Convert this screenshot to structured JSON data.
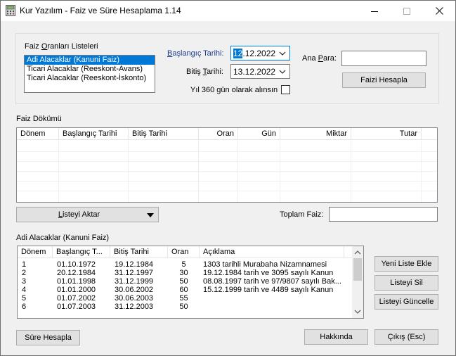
{
  "window": {
    "title": "Kur Yazılım - Faiz ve Süre Hesaplama 1.14",
    "minimize": "—",
    "maximize": "☐",
    "close": "✕"
  },
  "rates_group": {
    "label": "Faiz Oranları Listeleri",
    "items": [
      "Adi Alacaklar (Kanuni Faiz)",
      "Ticari Alacaklar (Reeskont-Avans)",
      "Ticari Alacaklar (Reeskont-İskonto)"
    ],
    "selected_index": 0
  },
  "dates": {
    "start_label": "Başlangıç Tarihi:",
    "start_value_sel": "12",
    "start_value_rest": ".12.2022",
    "end_label": "Bitiş Tarihi:",
    "end_value": "13.12.2022",
    "year360_label": "Yıl 360 gün olarak alınsın",
    "year360_checked": false
  },
  "principal": {
    "label": "Ana Para:",
    "value": "",
    "compute_button": "Faizi Hesapla"
  },
  "interest_breakdown": {
    "label": "Faiz Dökümü",
    "columns": [
      "Dönem",
      "Başlangıç Tarihi",
      "Bitiş Tarihi",
      "Oran",
      "Gün",
      "Miktar",
      "Tutar"
    ],
    "rows": []
  },
  "transfer_button": "Listeyi Aktar",
  "total_interest": {
    "label": "Toplam Faiz:",
    "value": ""
  },
  "rate_list": {
    "label": "Adi Alacaklar (Kanuni Faiz)",
    "columns": [
      "Dönem",
      "Başlangıç T...",
      "Bitiş Tarihi",
      "Oran",
      "Açıklama"
    ],
    "rows": [
      {
        "period": "1",
        "start": "01.10.1972",
        "end": "19.12.1984",
        "rate": "5",
        "desc": "1303 tarihli Murabaha Nizamnamesi"
      },
      {
        "period": "2",
        "start": "20.12.1984",
        "end": "31.12.1997",
        "rate": "30",
        "desc": "19.12.1984 tarih ve 3095 sayılı Kanun"
      },
      {
        "period": "3",
        "start": "01.01.1998",
        "end": "31.12.1999",
        "rate": "50",
        "desc": "08.08.1997 tarih ve 97/9807 sayılı Bak..."
      },
      {
        "period": "4",
        "start": "01.01.2000",
        "end": "30.06.2002",
        "rate": "60",
        "desc": "15.12.1999 tarih ve 4489 sayılı Kanun"
      },
      {
        "period": "5",
        "start": "01.07.2002",
        "end": "30.06.2003",
        "rate": "55",
        "desc": ""
      },
      {
        "period": "6",
        "start": "01.07.2003",
        "end": "31.12.2003",
        "rate": "50",
        "desc": ""
      }
    ]
  },
  "list_buttons": {
    "new": "Yeni Liste Ekle",
    "delete": "Listeyi Sil",
    "update": "Listeyi Güncelle"
  },
  "footer": {
    "duration": "Süre Hesapla",
    "about": "Hakkında",
    "exit": "Çıkış (Esc)"
  },
  "colors": {
    "selection": "#0078d7",
    "window_bg": "#f0f0f0",
    "button_bg": "#e1e1e1"
  }
}
